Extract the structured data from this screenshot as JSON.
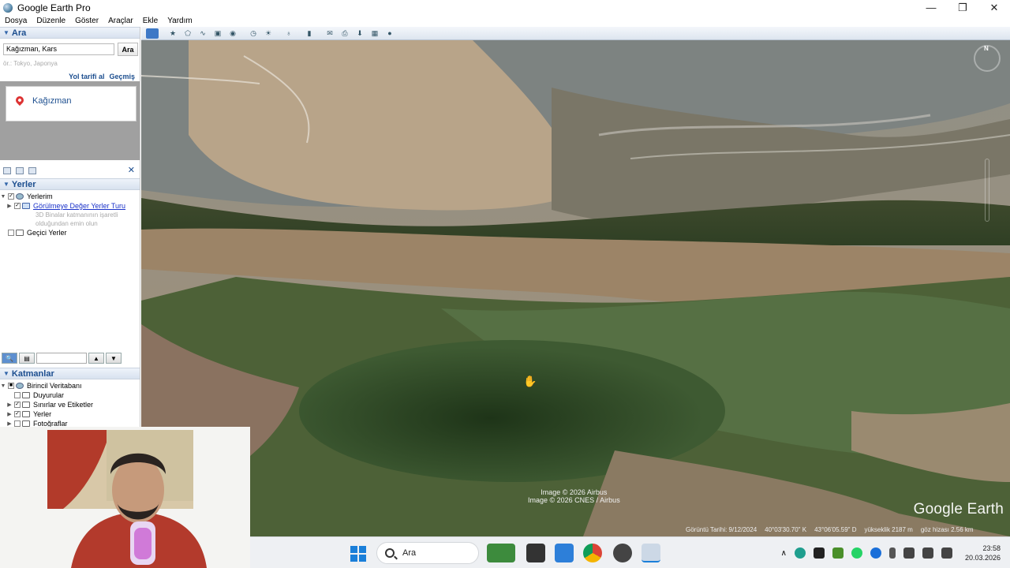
{
  "window": {
    "title": "Google Earth Pro",
    "controls": [
      "—",
      "❐",
      "✕"
    ]
  },
  "menu": [
    "Dosya",
    "Düzenle",
    "Göster",
    "Araçlar",
    "Ekle",
    "Yardım"
  ],
  "search_panel": {
    "header": "Ara",
    "query": "Kağızman, Kars",
    "button": "Ara",
    "hint": "ör.: Tokyo, Japonya",
    "link_directions": "Yol tarifi al",
    "link_history": "Geçmiş",
    "result": "Kağızman",
    "close": "✕"
  },
  "places_panel": {
    "header": "Yerler",
    "my_places": "Yerlerim",
    "tour": "Görülmeye Değer Yerler Turu",
    "tour_desc": "3D Binalar katmanının işaretli olduğundan emin olun",
    "temporary": "Geçici Yerler",
    "up": "▲",
    "down": "▼"
  },
  "layers_panel": {
    "header": "Katmanlar",
    "items": [
      "Birincil Veritabanı",
      "Duyurular",
      "Sınırlar ve Etiketler",
      "Yerler",
      "Fotoğraflar"
    ]
  },
  "map": {
    "attribution_1": "Image © 2026 Airbus",
    "attribution_2": "Image © 2026 CNES / Airbus",
    "brand": "Google Earth",
    "status": {
      "imagery_date": "Görüntü Tarihi: 9/12/2024",
      "lat": "40°03'30.70\" K",
      "lon": "43°06'05.59\" D",
      "elevation": "yükseklik  2187 m",
      "eye_alt": "göz hizası   2.56 km"
    },
    "compass_n": "N"
  },
  "taskbar": {
    "search_label": "Ara",
    "time": "23:58",
    "date": "20.03.2026"
  },
  "colors": {
    "accent": "#1c4e8f",
    "link": "#1a32c9",
    "start": "#1a7fd9"
  }
}
